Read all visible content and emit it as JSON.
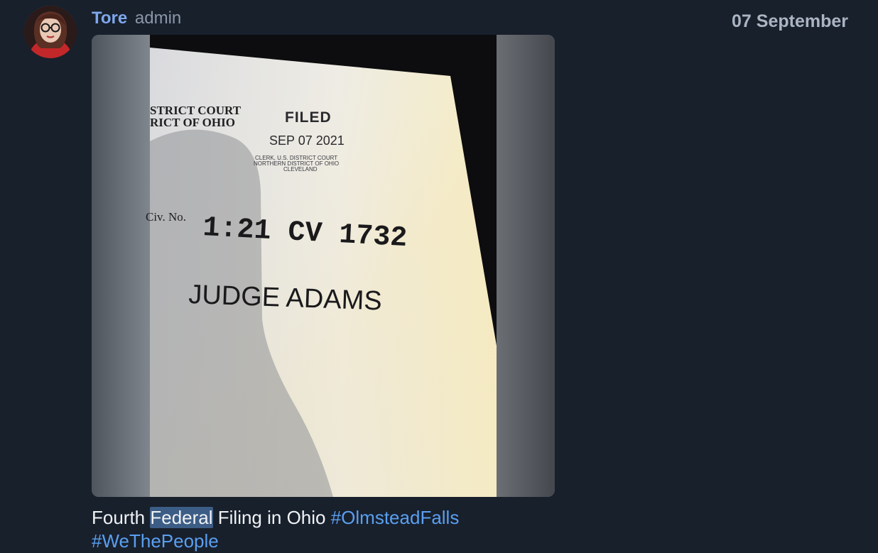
{
  "message": {
    "author": {
      "name": "Tore",
      "role": "admin",
      "avatar_icon": "user-avatar-photo"
    },
    "date": "07 September",
    "photo": {
      "document_text": {
        "court_header_line1": "STRICT COURT",
        "court_header_line2": "RICT OF OHIO",
        "filed_stamp": "FILED",
        "filed_date": "SEP 07 2021",
        "clerk_line1": "CLERK, U.S. DISTRICT COURT",
        "clerk_line2": "NORTHERN DISTRICT OF OHIO",
        "clerk_line3": "CLEVELAND",
        "civ_label": "Civ. No.",
        "case_number": "1:21 CV 1732",
        "judge": "JUDGE ADAMS"
      }
    },
    "caption": {
      "text_before": "Fourth ",
      "highlighted": "Federal",
      "text_after": " Filing in Ohio ",
      "hashtags": [
        "#OlmsteadFalls",
        "#WeThePeople"
      ]
    }
  },
  "colors": {
    "background": "#18202c",
    "author_name": "#7ea7ea",
    "hashtag": "#5a9ff0",
    "highlight": "#3c5d85"
  }
}
